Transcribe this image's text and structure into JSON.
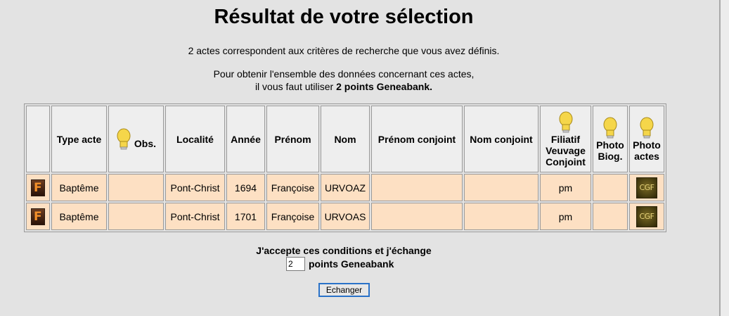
{
  "title": "Résultat de votre sélection",
  "count_text": "2 actes correspondent aux critères de recherche que vous avez définis.",
  "info_line1": "Pour obtenir l'ensemble des données concernant ces actes,",
  "info_line2_prefix": "il vous faut utiliser ",
  "info_line2_bold": "2 points Geneabank.",
  "table": {
    "headers": {
      "type_acte": "Type acte",
      "obs": "Obs.",
      "localite": "Localité",
      "annee": "Année",
      "prenom": "Prénom",
      "nom": "Nom",
      "prenom_conjoint": "Prénom conjoint",
      "nom_conjoint": "Nom conjoint",
      "filiatif_1": "Filiatif",
      "filiatif_2": "Veuvage",
      "filiatif_3": "Conjoint",
      "photo_biog_1": "Photo",
      "photo_biog_2": "Biog.",
      "photo_actes_1": "Photo",
      "photo_actes_2": "actes"
    },
    "rows": [
      {
        "type_acte": "Baptême",
        "obs": "",
        "localite": "Pont-Christ",
        "annee": "1694",
        "prenom": "Françoise",
        "nom": "URVOAZ",
        "prenom_conjoint": "",
        "nom_conjoint": "",
        "filiatif": "pm",
        "photo_biog": ""
      },
      {
        "type_acte": "Baptême",
        "obs": "",
        "localite": "Pont-Christ",
        "annee": "1701",
        "prenom": "Françoise",
        "nom": "URVOAS",
        "prenom_conjoint": "",
        "nom_conjoint": "",
        "filiatif": "pm",
        "photo_biog": ""
      }
    ]
  },
  "icons": {
    "detail": "detail-f-icon",
    "bulb": "lightbulb-icon",
    "cgf": "cgf-icon",
    "detail_letter": "F",
    "cgf_label": "CGF"
  },
  "accept_text": "J'accepte ces conditions et j'échange",
  "points_value": "2",
  "points_label": "points Geneabank",
  "button_label": "Echanger",
  "colors": {
    "row_bg": "#fde0c3",
    "header_bg": "#eeeeee",
    "page_bg": "#e3e3e3",
    "bulb": "#f5d64a"
  }
}
